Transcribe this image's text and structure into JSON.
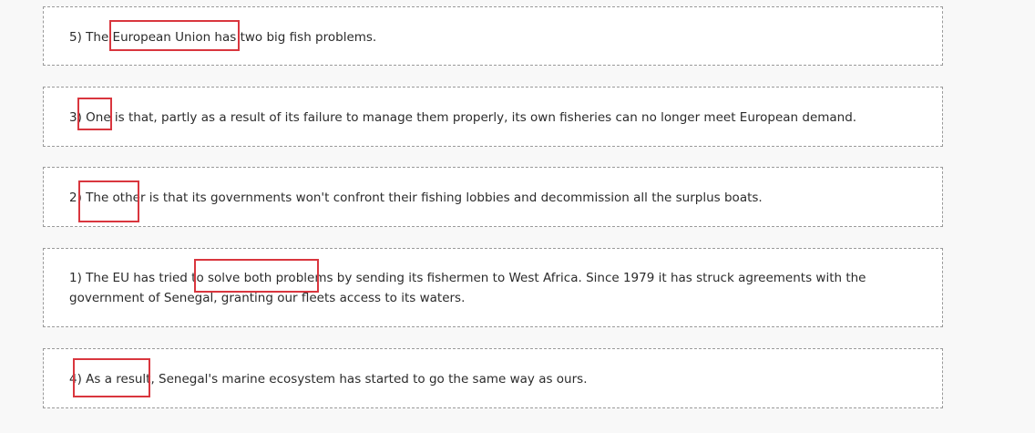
{
  "sentences": [
    {
      "text": "5) The European Union has two big fish problems."
    },
    {
      "text": "3) One is that, partly as a result of its failure to manage them properly, its own fisheries can no longer meet European demand."
    },
    {
      "text": "2) The other is that its governments won't confront their fishing lobbies and decommission all the surplus boats."
    },
    {
      "text": "1) The EU has tried to solve both problems by sending its fishermen to West Africa. Since 1979 it has struck agreements with the government of Senegal, granting our fleets access to its waters."
    },
    {
      "text": "4) As a result, Senegal's marine ecosystem has started to go the same way as ours."
    }
  ]
}
